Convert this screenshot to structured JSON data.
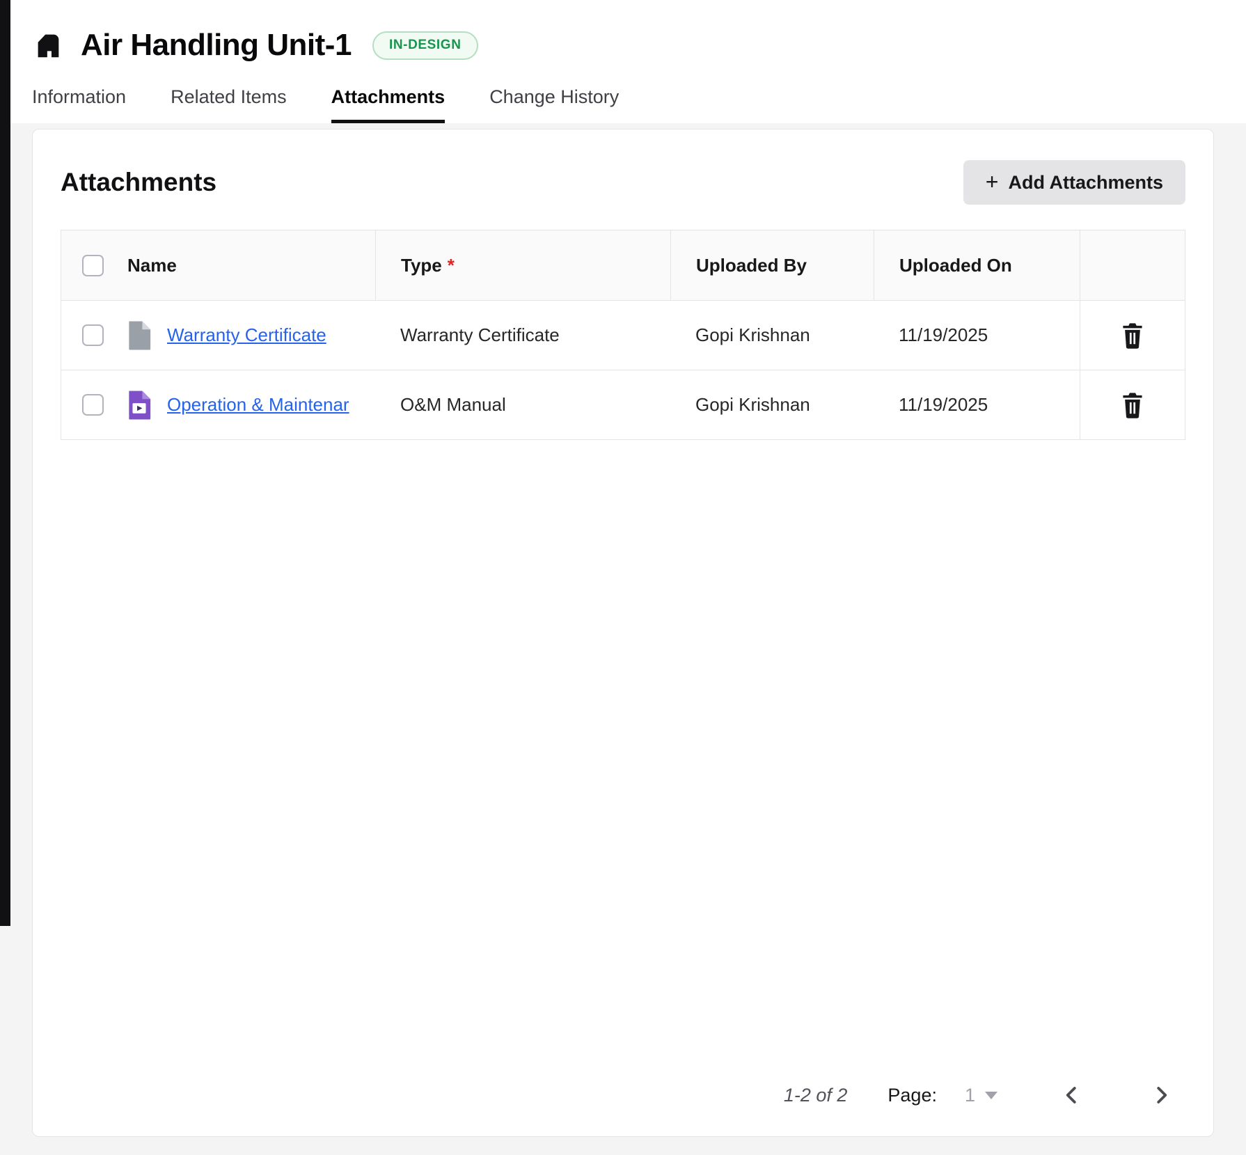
{
  "header": {
    "title": "Air Handling Unit-1",
    "status_badge": "IN-DESIGN",
    "tabs": [
      {
        "label": "Information"
      },
      {
        "label": "Related Items"
      },
      {
        "label": "Attachments"
      },
      {
        "label": "Change History"
      }
    ],
    "active_tab": "Attachments"
  },
  "attachments": {
    "section_title": "Attachments",
    "add_button_icon": "+",
    "add_button_label": "Add Attachments",
    "table": {
      "columns": [
        "Name",
        "Type",
        "Uploaded By",
        "Uploaded On"
      ],
      "type_required_marker": "*",
      "rows": [
        {
          "name": "Warranty Certificate",
          "type": "Warranty Certificate",
          "uploaded_by": "Gopi Krishnan",
          "uploaded_on": "11/19/2025",
          "icon": "document-file-icon"
        },
        {
          "name": "Operation & Maintenar",
          "type": "O&M Manual",
          "uploaded_by": "Gopi Krishnan",
          "uploaded_on": "11/19/2025",
          "icon": "slides-file-icon"
        }
      ]
    },
    "pagination": {
      "range_label": "1-2 of 2",
      "page_label": "Page:",
      "current_page": "1"
    }
  },
  "colors": {
    "status_badge_green": "#17954d",
    "link_blue": "#2563eb",
    "required_red": "#dc2626",
    "card_background": "#ffffff",
    "page_background": "#f4f4f5"
  }
}
